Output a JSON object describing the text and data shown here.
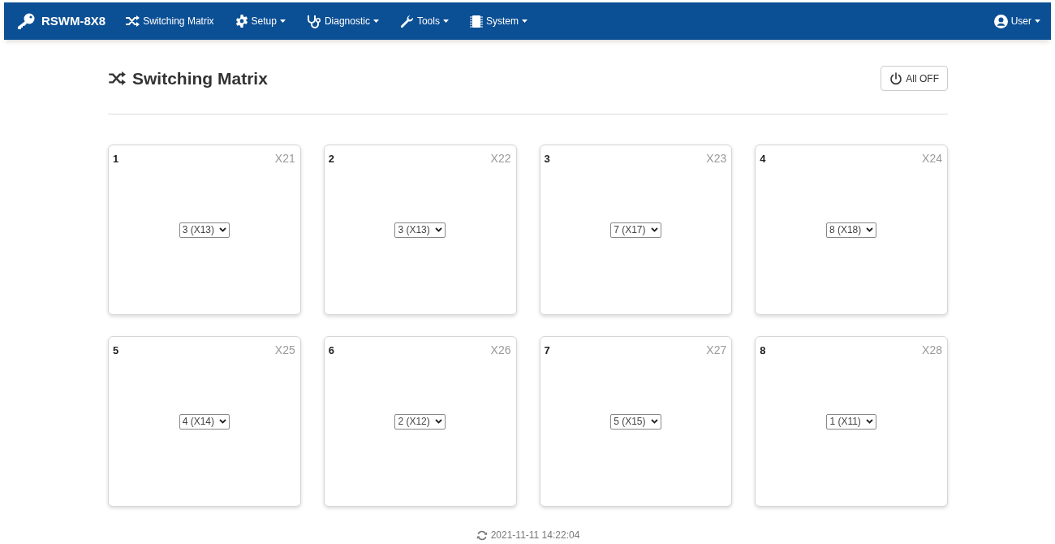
{
  "navbar": {
    "brand": "RSWM-8X8",
    "items": [
      {
        "label": "Switching Matrix",
        "dropdown": false
      },
      {
        "label": "Setup",
        "dropdown": true
      },
      {
        "label": "Diagnostic",
        "dropdown": true
      },
      {
        "label": "Tools",
        "dropdown": true
      },
      {
        "label": "System",
        "dropdown": true
      }
    ],
    "user": {
      "label": "User",
      "dropdown": true
    }
  },
  "page": {
    "title": "Switching Matrix",
    "all_off_button": "All OFF"
  },
  "outputs": [
    {
      "number": "1",
      "connector": "X21",
      "selected_input": "3 (X13)"
    },
    {
      "number": "2",
      "connector": "X22",
      "selected_input": "3 (X13)"
    },
    {
      "number": "3",
      "connector": "X23",
      "selected_input": "7 (X17)"
    },
    {
      "number": "4",
      "connector": "X24",
      "selected_input": "8 (X18)"
    },
    {
      "number": "5",
      "connector": "X25",
      "selected_input": "4 (X14)"
    },
    {
      "number": "6",
      "connector": "X26",
      "selected_input": "2 (X12)"
    },
    {
      "number": "7",
      "connector": "X27",
      "selected_input": "5 (X15)"
    },
    {
      "number": "8",
      "connector": "X28",
      "selected_input": "1 (X11)"
    }
  ],
  "footer": {
    "timestamp": "2021-11-11 14:22:04"
  }
}
